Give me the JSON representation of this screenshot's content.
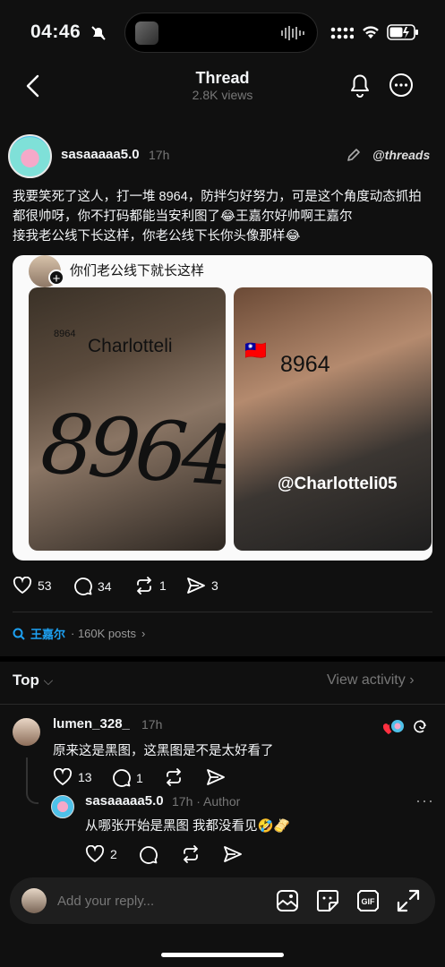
{
  "status": {
    "time": "04:46"
  },
  "header": {
    "title": "Thread",
    "views": "2.8K views"
  },
  "post": {
    "author": "sasaaaaa5.0",
    "time": "17h",
    "brand": "threads",
    "text_line1": "我要笑死了这人，打一堆 8964，防拌匀好努力，可是这个角度动态抓拍",
    "text_line2": "都很帅呀，你不打码都能当安利图了😂王嘉尔好帅啊王嘉尔",
    "text_line3": "接我老公线下长这样，你老公线下长你头像那样😂",
    "quote": {
      "text": "你们老公线下就长这样",
      "img1_small": "8964",
      "img1_name": "Charlotteli",
      "img1_big": "8964",
      "img2_flag": "🇹🇼",
      "img2_number": "8964",
      "img2_handle": "@Charlotteli05"
    },
    "likes": "53",
    "comments": "34",
    "reposts": "1",
    "shares": "3"
  },
  "topic": {
    "name": "王嘉尔",
    "posts": "· 160K posts"
  },
  "sort": {
    "label": "Top",
    "view_activity": "View activity"
  },
  "comments": [
    {
      "author": "lumen_328_",
      "time": "17h",
      "text": "原来这是黑图，这黑图是不是太好看了",
      "likes": "13",
      "replies": "1"
    },
    {
      "author": "sasaaaaa5.0",
      "meta": "17h · Author",
      "text": "从哪张开始是黑图 我都没看见🤣🫔",
      "likes": "2"
    }
  ],
  "reply_bar": {
    "placeholder": "Add your reply..."
  },
  "colors": {
    "background": "#101010",
    "accent_link": "#1da1f2",
    "like_heart": "#ff3040"
  },
  "icons": [
    "back-icon",
    "bell-icon",
    "more-icon",
    "edit-icon",
    "heart-icon",
    "comment-icon",
    "repost-icon",
    "share-icon",
    "search-icon",
    "chevron-down-icon",
    "chevron-right-icon",
    "image-icon",
    "sticker-icon",
    "gif-icon",
    "expand-icon"
  ]
}
